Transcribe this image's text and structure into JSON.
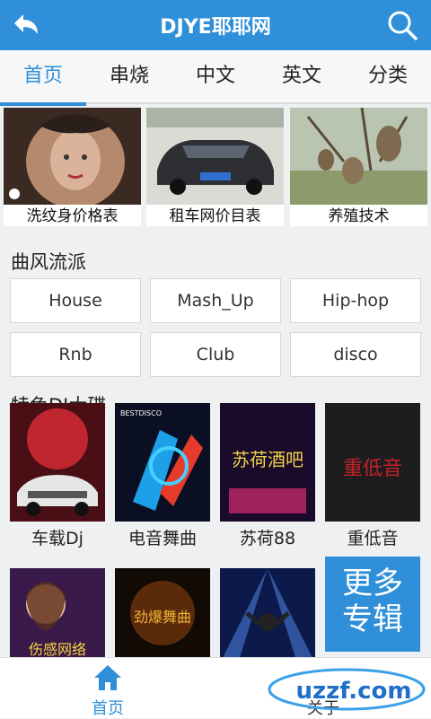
{
  "header": {
    "title": "DJYE耶耶网",
    "back_icon": "back-arrow-icon",
    "search_icon": "search-icon"
  },
  "tabs": [
    {
      "label": "首页",
      "active": true
    },
    {
      "label": "串烧"
    },
    {
      "label": "中文"
    },
    {
      "label": "英文"
    },
    {
      "label": "分类"
    }
  ],
  "banners": [
    {
      "caption": "洗纹身价格表"
    },
    {
      "caption": "租车网价目表"
    },
    {
      "caption": "养殖技术"
    }
  ],
  "genres": {
    "title": "曲风流派",
    "items": [
      "House",
      "Mash_Up",
      "Hip-hop",
      "Rnb",
      "Club",
      "disco"
    ]
  },
  "discs": {
    "title": "特色DJ大碟",
    "items": [
      {
        "caption": "车载Dj",
        "art_text": ""
      },
      {
        "caption": "电音舞曲",
        "art_text": "BESTDISCO"
      },
      {
        "caption": "苏荷88",
        "art_text": "苏荷酒吧"
      },
      {
        "caption": "重低音",
        "art_text": "重低音"
      },
      {
        "caption": "",
        "art_text": "伤感网络"
      },
      {
        "caption": "",
        "art_text": "劲爆舞曲"
      },
      {
        "caption": "",
        "art_text": ""
      }
    ],
    "more_label_1": "更多",
    "more_label_2": "专辑"
  },
  "bottom_nav": [
    {
      "label": "首页",
      "icon": "home-icon",
      "active": true
    },
    {
      "label": "关于",
      "icon": "info-icon"
    }
  ],
  "watermark": "uzzf.com",
  "colors": {
    "accent": "#2f8fd8",
    "background": "#eef0f2"
  }
}
